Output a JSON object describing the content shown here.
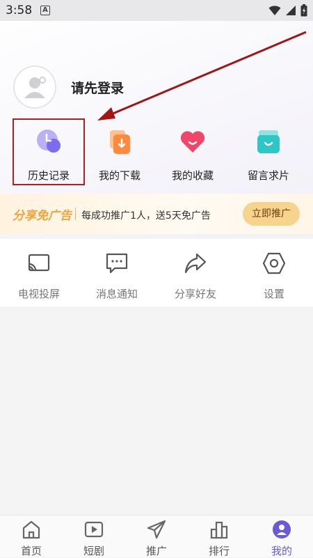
{
  "status_bar": {
    "time": "3:58",
    "notification": "A"
  },
  "profile": {
    "login_prompt": "请先登录",
    "avatar_icon": "user-icon"
  },
  "quick_actions": [
    {
      "label": "历史记录",
      "icon": "clock-icon",
      "color": "#7c6cf0"
    },
    {
      "label": "我的下载",
      "icon": "download-icon",
      "color": "#ff8a3d"
    },
    {
      "label": "我的收藏",
      "icon": "heart-icon",
      "color": "#f0466a"
    },
    {
      "label": "留言求片",
      "icon": "message-box-icon",
      "color": "#2ec6c6"
    }
  ],
  "ad_banner": {
    "title": "分享免广告",
    "description": "每成功推广1人，送5天免广告",
    "button": "立即推广",
    "accent": "#f0a43a"
  },
  "tools": [
    {
      "label": "电视投屏",
      "icon": "cast-icon"
    },
    {
      "label": "消息通知",
      "icon": "chat-icon"
    },
    {
      "label": "分享好友",
      "icon": "share-icon"
    },
    {
      "label": "设置",
      "icon": "settings-hexagon-icon"
    }
  ],
  "tab_bar": {
    "active_color": "#6a5ad8",
    "items": [
      {
        "label": "首页",
        "icon": "home-icon"
      },
      {
        "label": "短剧",
        "icon": "play-icon"
      },
      {
        "label": "推广",
        "icon": "paper-plane-icon"
      },
      {
        "label": "排行",
        "icon": "ranking-icon"
      },
      {
        "label": "我的",
        "icon": "profile-icon",
        "active": true
      }
    ]
  }
}
